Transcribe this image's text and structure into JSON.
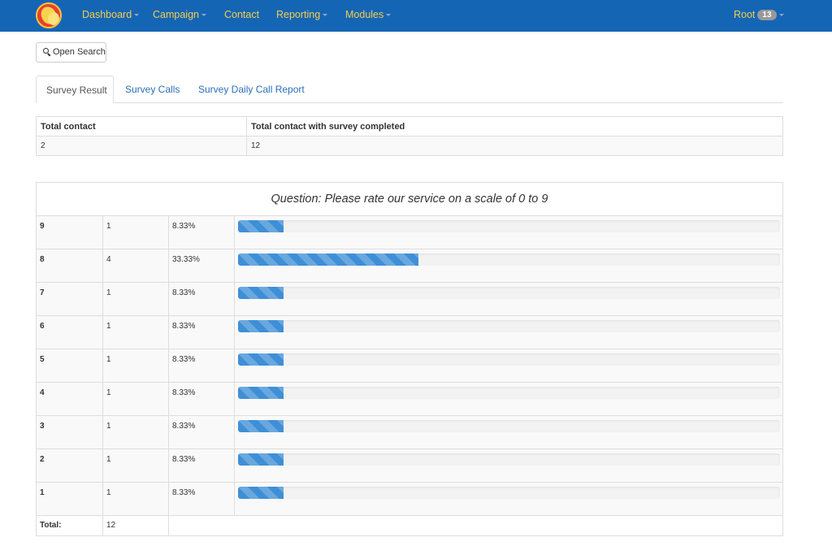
{
  "navbar": {
    "items": [
      {
        "label": "Dashboard",
        "has_caret": true
      },
      {
        "label": "Campaign",
        "has_caret": true
      },
      {
        "label": "Contact",
        "has_caret": false
      },
      {
        "label": "Reporting",
        "has_caret": true
      },
      {
        "label": "Modules",
        "has_caret": true
      }
    ],
    "user": {
      "label": "Root",
      "badge": "13"
    },
    "colors": {
      "background": "#1565b5",
      "link": "#f4cf4a"
    }
  },
  "search_button": {
    "label": "Open Search",
    "icon": "zoom-in-icon"
  },
  "tabs": [
    {
      "label": "Survey Result",
      "active": true
    },
    {
      "label": "Survey Calls",
      "active": false
    },
    {
      "label": "Survey Daily Call Report",
      "active": false
    }
  ],
  "summary": {
    "headers": [
      "Total contact",
      "Total contact with survey completed"
    ],
    "values": [
      "2",
      "12"
    ]
  },
  "question": {
    "title": "Question: Please rate our service on a scale of 0 to 9",
    "rows": [
      {
        "answer": "9",
        "count": "1",
        "percent": "8.33%",
        "fill": 8.33
      },
      {
        "answer": "8",
        "count": "4",
        "percent": "33.33%",
        "fill": 33.33
      },
      {
        "answer": "7",
        "count": "1",
        "percent": "8.33%",
        "fill": 8.33
      },
      {
        "answer": "6",
        "count": "1",
        "percent": "8.33%",
        "fill": 8.33
      },
      {
        "answer": "5",
        "count": "1",
        "percent": "8.33%",
        "fill": 8.33
      },
      {
        "answer": "4",
        "count": "1",
        "percent": "8.33%",
        "fill": 8.33
      },
      {
        "answer": "3",
        "count": "1",
        "percent": "8.33%",
        "fill": 8.33
      },
      {
        "answer": "2",
        "count": "1",
        "percent": "8.33%",
        "fill": 8.33
      },
      {
        "answer": "1",
        "count": "1",
        "percent": "8.33%",
        "fill": 8.33
      }
    ],
    "total_label": "Total:",
    "total_value": "12",
    "bar_color": "#3f8fd6"
  }
}
